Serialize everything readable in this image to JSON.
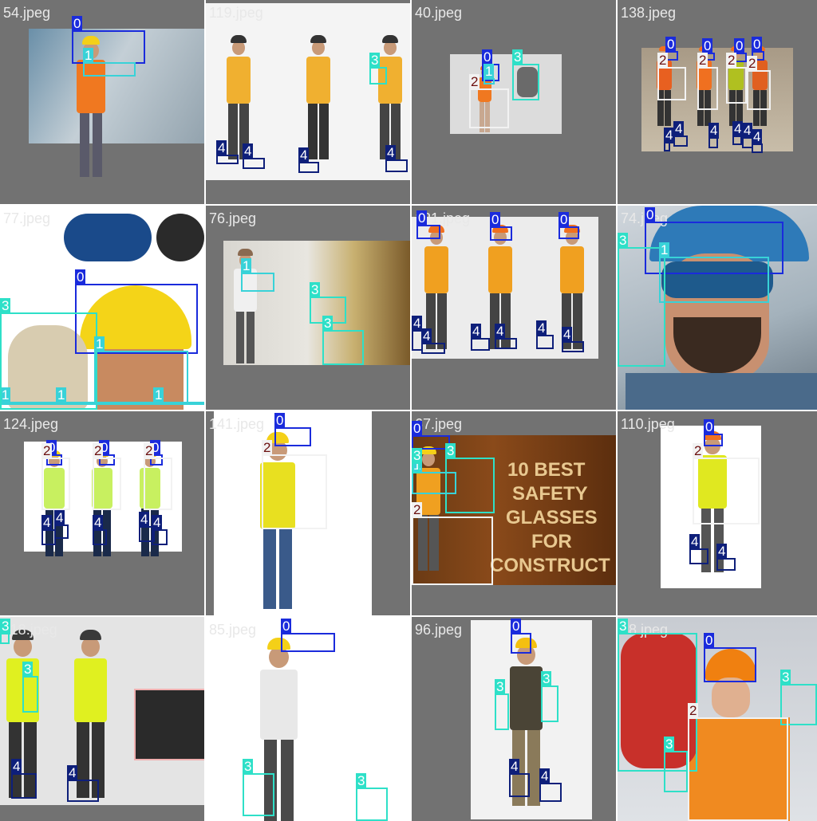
{
  "grid_title": "",
  "colors": {
    "class_0": "#1a2bdc",
    "class_1": "#38d2d8",
    "class_2": "#f2f2f2",
    "class_3": "#2ee0c8",
    "class_4": "#0e1f7a",
    "tile_background": "#727272"
  },
  "class_labels": [
    "0",
    "1",
    "2",
    "3",
    "4"
  ],
  "tiles": [
    {
      "name": "54.jpeg",
      "scene": "smiling worker in yellow hard hat and safety vest",
      "labels": [
        "0",
        "1"
      ]
    },
    {
      "name": "119.jpeg",
      "scene": "three painters in overalls rolling a ceiling",
      "labels": [
        "3",
        "4",
        "4",
        "4",
        "4"
      ]
    },
    {
      "name": "40.jpeg",
      "scene": "worker in orange vest holding up grey glove",
      "labels": [
        "0",
        "1",
        "2",
        "3"
      ]
    },
    {
      "name": "138.jpeg",
      "scene": "four workers in orange vests standing in a room",
      "labels": [
        "0",
        "0",
        "0",
        "0",
        "2",
        "2",
        "2",
        "2",
        "4",
        "4",
        "4",
        "4",
        "4",
        "4"
      ]
    },
    {
      "name": "77.jpeg",
      "scene": "safety glasses, yellow hard hat and work glove",
      "labels": [
        "1",
        "1",
        "1",
        "0",
        "3",
        "1"
      ]
    },
    {
      "name": "76.jpeg",
      "scene": "worker in goggles installing insulation",
      "labels": [
        "1",
        "3",
        "3"
      ]
    },
    {
      "name": "121.jpeg",
      "scene": "three workers in orange hard hats walking",
      "labels": [
        "0",
        "0",
        "0",
        "4",
        "4",
        "4",
        "4",
        "4",
        "4"
      ]
    },
    {
      "name": "74.jpeg",
      "scene": "bearded man in blue hard hat and goggles",
      "labels": [
        "0",
        "3",
        "1"
      ]
    },
    {
      "name": "124.jpeg",
      "scene": "three workers in green vests with hammers",
      "labels": [
        "0",
        "0",
        "0",
        "2",
        "2",
        "2",
        "4",
        "4",
        "4",
        "4",
        "4"
      ]
    },
    {
      "name": "141.jpeg",
      "scene": "worker in yellow hat and vest with crossed arms",
      "labels": [
        "0",
        "2"
      ]
    },
    {
      "name": "67.jpeg",
      "scene": "worker beside banner text",
      "banner": [
        "10 BEST",
        "SAFETY",
        "GLASSES",
        "FOR",
        "CONSTRUCT"
      ],
      "labels": [
        "0",
        "3",
        "1",
        "3",
        "2"
      ]
    },
    {
      "name": "110.jpeg",
      "scene": "worker holding clipboard",
      "labels": [
        "0",
        "2",
        "4",
        "4"
      ]
    },
    {
      "name": "118.jpeg",
      "scene": "worker in yellow vest with device product panels",
      "labels": [
        "3",
        "3",
        "4",
        "4"
      ]
    },
    {
      "name": "85.jpeg",
      "scene": "worker wearing fall protection harness",
      "labels": [
        "0",
        "3",
        "3"
      ]
    },
    {
      "name": "96.jpeg",
      "scene": "worker in brown t-shirt and cargo pants",
      "labels": [
        "0",
        "3",
        "3",
        "4",
        "4"
      ]
    },
    {
      "name": "38.jpeg",
      "scene": "man in orange hard hat with red gloves",
      "labels": [
        "3",
        "0",
        "3",
        "2",
        "3"
      ]
    }
  ]
}
